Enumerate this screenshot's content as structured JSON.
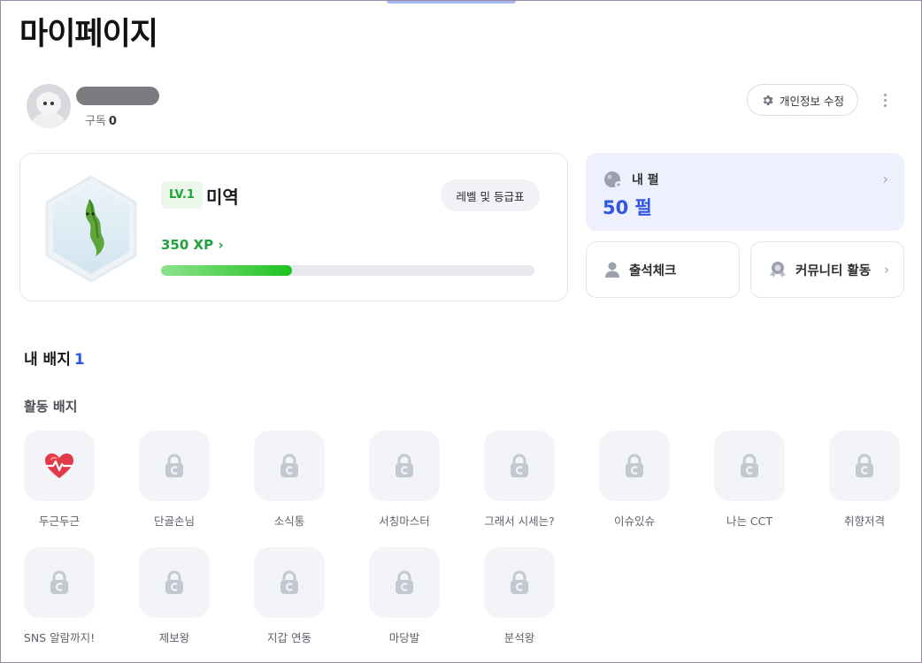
{
  "page": {
    "title": "마이페이지"
  },
  "profile": {
    "subscribe_label": "구독",
    "subscribe_count": "0",
    "edit_button": "개인정보 수정"
  },
  "level": {
    "badge": "LV.1",
    "name": "미역",
    "grade_button": "레벨 및 등급표",
    "xp_text": "350 XP",
    "progress_percent": 35
  },
  "pearl": {
    "label": "내 펄",
    "value": "50 펄"
  },
  "cards": {
    "attendance": "출석체크",
    "community": "커뮤니티 활동"
  },
  "badges": {
    "section_title": "내 배지",
    "count": "1",
    "activity_title": "활동 배지",
    "items": [
      {
        "label": "두근두근",
        "unlocked": true,
        "icon": "heartbeat-icon"
      },
      {
        "label": "단골손님",
        "unlocked": false,
        "icon": "lock-icon"
      },
      {
        "label": "소식통",
        "unlocked": false,
        "icon": "lock-icon"
      },
      {
        "label": "서칭마스터",
        "unlocked": false,
        "icon": "lock-icon"
      },
      {
        "label": "그래서 시세는?",
        "unlocked": false,
        "icon": "lock-icon"
      },
      {
        "label": "이슈있슈",
        "unlocked": false,
        "icon": "lock-icon"
      },
      {
        "label": "나는 CCT",
        "unlocked": false,
        "icon": "lock-icon"
      },
      {
        "label": "취향저격",
        "unlocked": false,
        "icon": "lock-icon"
      },
      {
        "label": "SNS 알람까지!",
        "unlocked": false,
        "icon": "lock-icon"
      },
      {
        "label": "제보왕",
        "unlocked": false,
        "icon": "lock-icon"
      },
      {
        "label": "지갑 연동",
        "unlocked": false,
        "icon": "lock-icon"
      },
      {
        "label": "마당발",
        "unlocked": false,
        "icon": "lock-icon"
      },
      {
        "label": "분석왕",
        "unlocked": false,
        "icon": "lock-icon"
      }
    ]
  },
  "colors": {
    "accent_blue": "#3356e0",
    "level_green": "#1fa33a",
    "tile_bg": "#f3f4f7"
  }
}
